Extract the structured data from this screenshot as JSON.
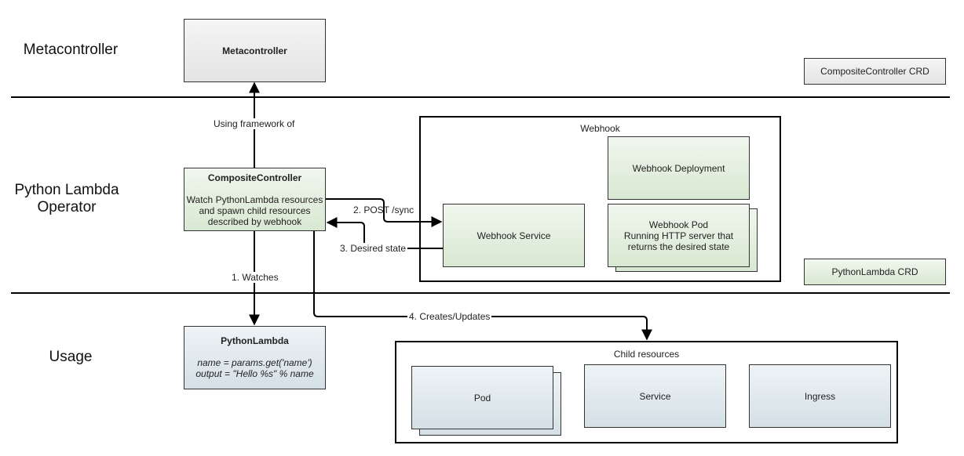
{
  "lanes": {
    "metacontroller": "Metacontroller",
    "operator_line1": "Python Lambda",
    "operator_line2": "Operator",
    "usage": "Usage"
  },
  "nodes": {
    "metacontroller": {
      "title": "Metacontroller"
    },
    "composite_controller": {
      "title": "CompositeController",
      "desc_line1": "Watch PythonLambda resources",
      "desc_line2": "and spawn child resources",
      "desc_line3": "described by webhook"
    },
    "python_lambda": {
      "title": "PythonLambda",
      "code_line1": "name = params.get('name')",
      "code_line2": "output = \"Hello %s\" % name"
    },
    "composite_controller_crd": "CompositeController CRD",
    "python_lambda_crd": "PythonLambda CRD",
    "webhook_group": {
      "title": "Webhook",
      "deployment": "Webhook Deployment",
      "service": "Webhook Service",
      "pod_line1": "Webhook Pod",
      "pod_line2": "Running HTTP server that",
      "pod_line3": "returns the desired state"
    },
    "child_resources": {
      "title": "Child resources",
      "pod": "Pod",
      "service": "Service",
      "ingress": "Ingress"
    }
  },
  "edges": {
    "using_framework": "Using framework of",
    "watches": "1. Watches",
    "post_sync": "2. POST /sync",
    "desired_state": "3. Desired state",
    "creates_updates": "4. Creates/Updates"
  },
  "colors": {
    "gray_fill": "#e9e9e9",
    "green_fill": "#e3efdd",
    "blue_fill": "#dfe8ed",
    "line": "#000000"
  }
}
